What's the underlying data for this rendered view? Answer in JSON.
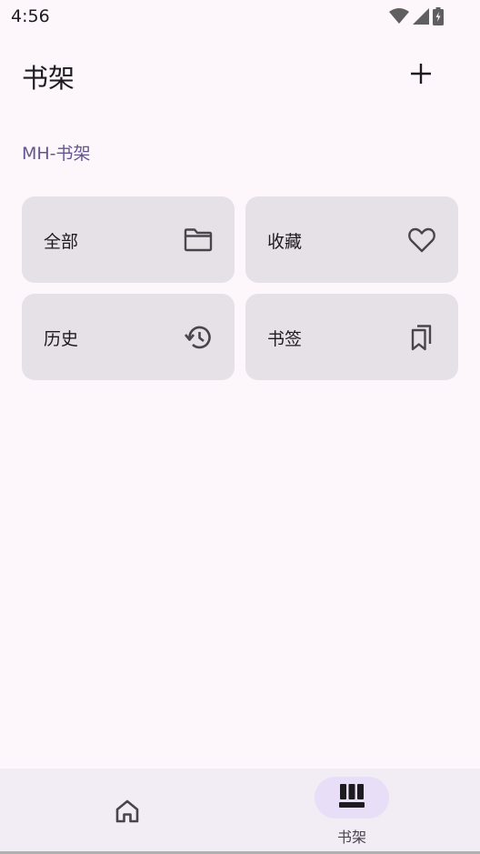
{
  "status_bar": {
    "time": "4:56",
    "icons": [
      "wifi-icon",
      "signal-icon",
      "battery-icon"
    ]
  },
  "app_bar": {
    "title": "书架",
    "action_icon": "add-icon"
  },
  "section": {
    "label": "MH-书架"
  },
  "cards": [
    {
      "label": "全部",
      "icon": "folder-icon"
    },
    {
      "label": "收藏",
      "icon": "heart-icon"
    },
    {
      "label": "历史",
      "icon": "history-icon"
    },
    {
      "label": "书签",
      "icon": "bookmarks-icon"
    }
  ],
  "bottom_nav": {
    "items": [
      {
        "label": "",
        "icon": "home-icon",
        "selected": false
      },
      {
        "label": "书架",
        "icon": "shelf-icon",
        "selected": true
      }
    ]
  },
  "colors": {
    "background": "#fdf7fc",
    "card": "#e6e1e6",
    "accent": "#65558f",
    "nav_background": "#f2ecf4",
    "nav_indicator": "#e8def8"
  }
}
